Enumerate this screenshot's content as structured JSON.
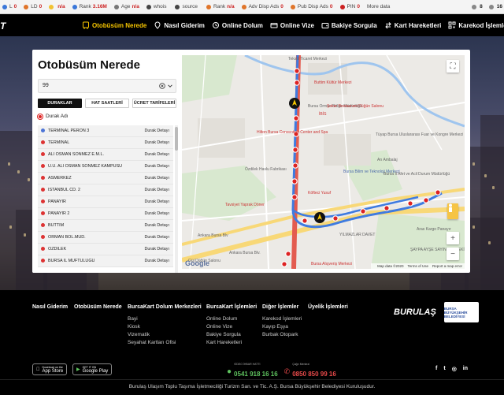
{
  "seobar": {
    "items": [
      {
        "label": "L",
        "value": "0",
        "color": "#3a77d9"
      },
      {
        "label": "LD",
        "value": "0",
        "color": "#e0752a"
      },
      {
        "label": "",
        "value": "n/a",
        "color": "#f1c232"
      },
      {
        "label": "Rank",
        "value": "3.16M",
        "color": "#3a77d9"
      },
      {
        "label": "Age",
        "value": "n/a",
        "color": "#777"
      },
      {
        "label": "whois",
        "value": "",
        "color": "#444"
      },
      {
        "label": "source",
        "value": "",
        "color": "#444"
      },
      {
        "label": "Rank",
        "value": "n/a",
        "color": "#e0752a"
      },
      {
        "label": "Adv Disp Ads",
        "value": "0",
        "color": "#e0752a"
      },
      {
        "label": "Pub Disp Ads",
        "value": "0",
        "color": "#e0752a"
      },
      {
        "label": "PIN",
        "value": "0",
        "color": "#c22"
      }
    ],
    "more": "More data",
    "right_values": [
      "8",
      "16"
    ]
  },
  "nav": {
    "logo": "T",
    "items": [
      {
        "label": "Otobüsüm Nerede",
        "icon": "bus-icon",
        "active": true
      },
      {
        "label": "Nasıl Giderim",
        "icon": "pin-icon",
        "active": false
      },
      {
        "label": "Online Dolum",
        "icon": "refill-icon",
        "active": false
      },
      {
        "label": "Online Vize",
        "icon": "card-icon",
        "active": false
      },
      {
        "label": "Bakiye Sorgula",
        "icon": "wallet-icon",
        "active": false
      },
      {
        "label": "Kart Hareketleri",
        "icon": "swap-icon",
        "active": false
      },
      {
        "label": "Karekod İşlemleri",
        "icon": "qr-icon",
        "active": false
      }
    ]
  },
  "panel": {
    "title": "Otobüsüm Nerede",
    "line_value": "99",
    "tabs": [
      "DURAKLAR",
      "HAT SAATLERİ",
      "ÜCRET TARİFELERİ"
    ],
    "durak_label": "Durak Adı",
    "detail_label": "Durak Detayı",
    "stops": [
      {
        "name": "TERMİNAL PERON 3",
        "current": true
      },
      {
        "name": "TERMİNAL",
        "current": false
      },
      {
        "name": "ALİ OSMAN SÖNMEZ E.M.L.",
        "current": false
      },
      {
        "name": "U.Ü. ALİ OSMAN SÖNMEZ KAMPÜSÜ",
        "current": false
      },
      {
        "name": "ASMERKEZ",
        "current": false
      },
      {
        "name": "İSTANBUL CD. 2",
        "current": false
      },
      {
        "name": "PANAYIR",
        "current": false
      },
      {
        "name": "PANAYIR 2",
        "current": false
      },
      {
        "name": "BUTTİM",
        "current": false
      },
      {
        "name": "ORMAN BÖL.MÜD.",
        "current": false
      },
      {
        "name": "ÖZDİLEK",
        "current": false
      },
      {
        "name": "BURSA İL MÜFTÜLÜĞÜ",
        "current": false
      }
    ]
  },
  "map": {
    "labels": [
      {
        "text": "Tekstil Ticaret Merkezi",
        "cls": ""
      },
      {
        "text": "Buttim Kültür Merkezi",
        "cls": "poi"
      },
      {
        "text": "Bursa Orman Bölge Müdürlüğü",
        "cls": ""
      },
      {
        "text": "Şeker Restaurant Düğün Salonu",
        "cls": "poi"
      },
      {
        "text": "İBİS",
        "cls": "poi"
      },
      {
        "text": "Tüyap Bursa Uluslararası Fuar ve Kongre Merkezi",
        "cls": ""
      },
      {
        "text": "Hilton Bursa Convention Center and Spa",
        "cls": "poi"
      },
      {
        "text": "Bursa Bilim ve Teknoloji Merkezi",
        "cls": "blue"
      },
      {
        "text": "Özdilek Havlu Fabrikası",
        "cls": ""
      },
      {
        "text": "Köfteci Yusuf",
        "cls": "poi"
      },
      {
        "text": "Tavsiyet Yaprak Döner",
        "cls": "poi"
      },
      {
        "text": "Bursa İl Afet ve Acil Durum Müdürlüğü",
        "cls": ""
      },
      {
        "text": "Arı Ambalaj",
        "cls": ""
      },
      {
        "text": "YILMAZLAR DAVET",
        "cls": ""
      },
      {
        "text": "Aras Kargo Panayır",
        "cls": ""
      },
      {
        "text": "ŞAYPA AYŞE SAYIN MESLEKİ VE...",
        "cls": ""
      },
      {
        "text": "Gül Düğün Salonu",
        "cls": ""
      },
      {
        "text": "Bursa Alışveriş Merkezi",
        "cls": "poi"
      },
      {
        "text": "Ankara Bursa Blv.",
        "cls": ""
      },
      {
        "text": "Ankara Bursa Blv",
        "cls": ""
      }
    ],
    "attribution": [
      "Map data ©2020",
      "Terms of Use",
      "Report a map error"
    ],
    "google": "Google",
    "fullscreen": "⛶",
    "zoom_in": "+",
    "zoom_out": "−"
  },
  "footer": {
    "columns": [
      {
        "heading": "Nasıl Giderim",
        "links": []
      },
      {
        "heading": "Otobüsüm Nerede",
        "links": []
      },
      {
        "heading": "BursaKart Dolum Merkezleri",
        "links": [
          "Bayi",
          "Kiosk",
          "Vizematik",
          "Seyahat Kartları Ofisi"
        ]
      },
      {
        "heading": "BursaKart İşlemleri",
        "links": [
          "Online Dolum",
          "Online Vize",
          "Bakiye Sorgula",
          "Kart Hareketleri"
        ]
      },
      {
        "heading": "Diğer İşlemler",
        "links": [
          "Karekod İşlemleri",
          "Kayıp Eşya",
          "Burbak Otopark"
        ]
      },
      {
        "heading": "Üyelik İşlemleri",
        "links": []
      }
    ],
    "burulas": "BURULAŞ",
    "bbb": "BURSA BÜYÜKŞEHİR BELEDİYESİ",
    "app_store": {
      "small": "Download on the",
      "big": "App Store"
    },
    "google_play": {
      "small": "GET IT ON",
      "big": "Google Play"
    },
    "whatsapp_label": "VİDEO İHBAR HATTI",
    "whatsapp": "0541 918 16 16",
    "callcenter_label": "Çağrı Merkezi",
    "callcenter": "0850 850 99 16",
    "social": [
      "f",
      "t",
      "◎",
      "in"
    ],
    "copyright": "Burulaş Ulaşım Toplu Taşıma İşletmeciliği Turizm San. ve Tic. A.Ş. Bursa Büyükşehir Belediyesi Kuruluşudur."
  }
}
